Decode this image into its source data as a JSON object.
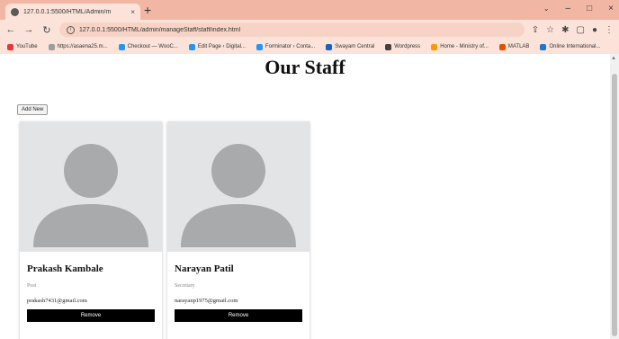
{
  "browser": {
    "tab_title": "127.0.0.1:5500/HTML/Admin/m",
    "tab_close": "×",
    "new_tab": "+",
    "url": "127.0.0.1:5500/HTML/admin/manageStaff/staff/index.html",
    "window_controls": {
      "dropdown": "⌄",
      "minimize": "–",
      "maximize": "□",
      "close": "×"
    },
    "bookmarks": [
      {
        "label": "YouTube",
        "color": "#e53935"
      },
      {
        "label": "https://asaena25.m...",
        "color": "#9e9e9e"
      },
      {
        "label": "Checkout — WooC...",
        "color": "#2196f3"
      },
      {
        "label": "Edit Page ‹ Digital...",
        "color": "#2196f3"
      },
      {
        "label": "Forminator › Conta...",
        "color": "#2196f3"
      },
      {
        "label": "Swayam Central",
        "color": "#1565c0"
      },
      {
        "label": "Wordpress",
        "color": "#424242"
      },
      {
        "label": "Home - Ministry of...",
        "color": "#ff9800"
      },
      {
        "label": "MATLAB",
        "color": "#e65100"
      },
      {
        "label": "Online International...",
        "color": "#1976d2"
      }
    ]
  },
  "page": {
    "title": "Our Staff",
    "add_button": "Add New"
  },
  "staff": [
    {
      "name": "Prakash Kambale",
      "role": "Post",
      "email": "prakash7431@gmail.com",
      "remove": "Remove"
    },
    {
      "name": "Narayan Patil",
      "role": "Secretary",
      "email": "narayanp1975@gmail.com",
      "remove": "Remove"
    }
  ]
}
